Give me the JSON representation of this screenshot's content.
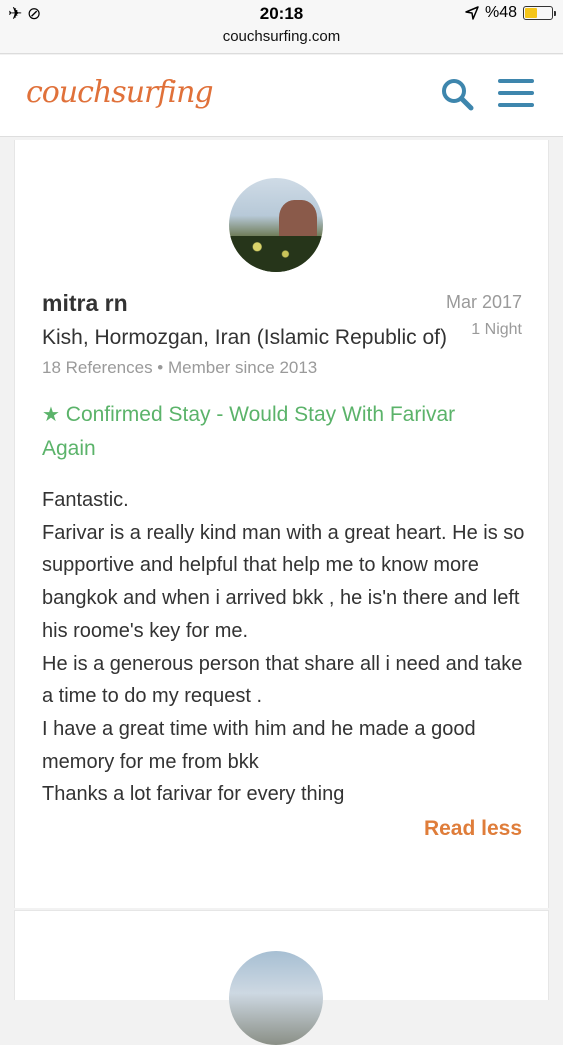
{
  "status_bar": {
    "left_icons": "✈ ⊘",
    "time": "20:18",
    "battery_text": "%48",
    "location_icon": "location-arrow-icon",
    "battery_level": 0.48
  },
  "browser": {
    "url": "couchsurfing.com"
  },
  "header": {
    "logo_text": "couchsurfing",
    "search_icon": "search-icon",
    "menu_icon": "hamburger-menu-icon",
    "brand_color": "#e0713a",
    "icon_color": "#3e86ad"
  },
  "reference": {
    "name": "mitra rn",
    "date": "Mar 2017",
    "location": "Kish, Hormozgan, Iran (Islamic Republic of)",
    "nights": "1 Night",
    "meta": "18 References • Member since 2013",
    "confirmed_label": "Confirmed Stay - Would Stay With Farivar Again",
    "confirmed_color": "#5bb36a",
    "body_lines": [
      "Fantastic.",
      "Farivar is a really kind man with a great heart. He is so supportive and helpful that help me to know more bangkok and when i arrived bkk , he is'n there and left his roome's key for me.",
      "He is a generous person that share all i need and take a time to do my request .",
      "I have a great time with him and he made a good memory for me from bkk",
      "Thanks a lot farivar for every thing"
    ],
    "read_less_label": "Read less"
  }
}
